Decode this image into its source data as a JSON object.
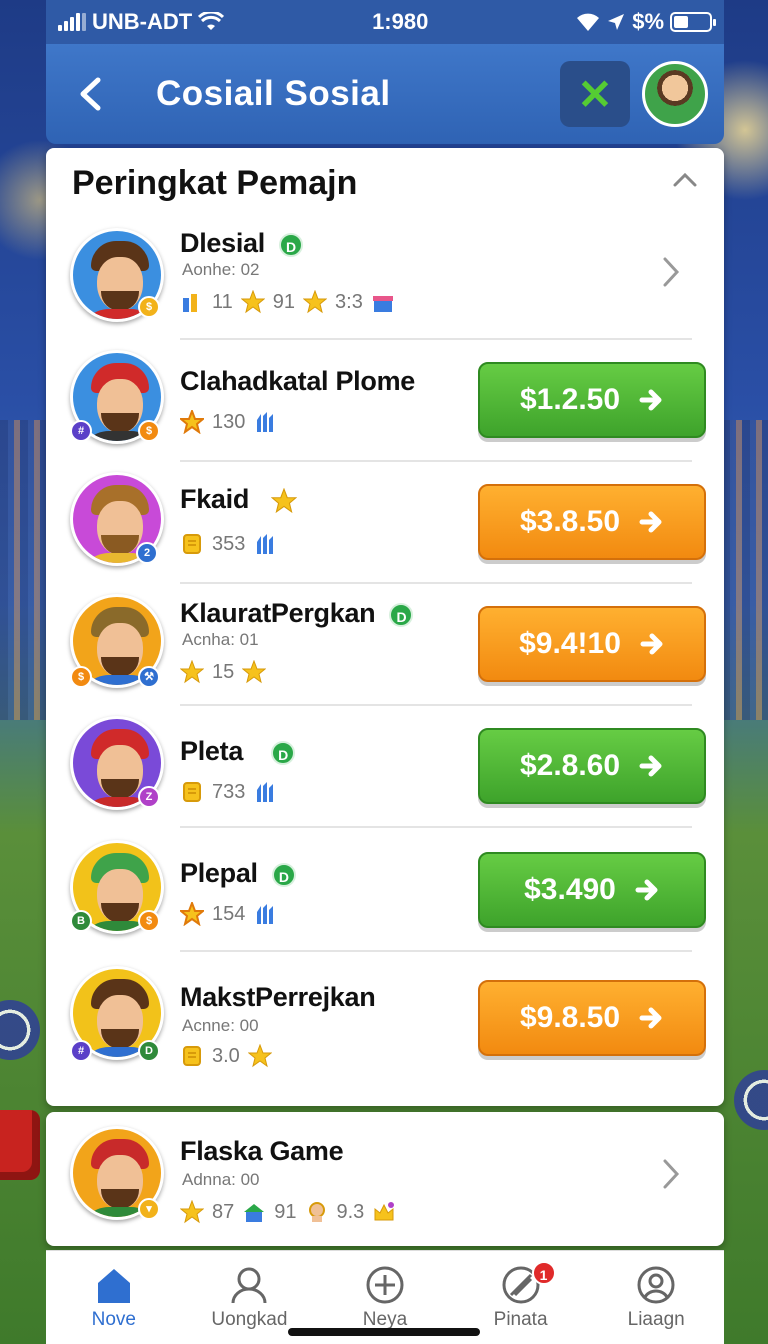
{
  "status_bar": {
    "carrier": "UNB-ADT",
    "time": "1:980",
    "right_text": "$%"
  },
  "header": {
    "title": "Cosiail Sosial"
  },
  "leaderboard": {
    "title": "Peringkat Pemajn",
    "rows": [
      {
        "name": "Dlesial",
        "sub": "Aonhe: 02",
        "stats": [
          "11",
          "91",
          "3:3"
        ],
        "action": "chevron"
      },
      {
        "name": "Clahadkatal Plome",
        "stats": [
          "130"
        ],
        "price": "$1.2.50",
        "btn_color": "green"
      },
      {
        "name": "Fkaid",
        "stats": [
          "353"
        ],
        "price": "$3.8.50",
        "btn_color": "orange"
      },
      {
        "name": "KlauratPergkan",
        "sub": "Acnha: 01",
        "stats": [
          "15"
        ],
        "price": "$9.4!10",
        "btn_color": "orange"
      },
      {
        "name": "Pleta",
        "stats": [
          "733"
        ],
        "price": "$2.8.60",
        "btn_color": "green"
      },
      {
        "name": "Plepal",
        "stats": [
          "154"
        ],
        "price": "$3.490",
        "btn_color": "green"
      },
      {
        "name": "MakstPerrejkan",
        "sub": "Acnne: 00",
        "stats": [
          "3.0"
        ],
        "price": "$9.8.50",
        "btn_color": "orange"
      }
    ]
  },
  "featured": {
    "name": "Flaska Game",
    "sub": "Adnna: 00",
    "stats": [
      "87",
      "91",
      "9.3"
    ]
  },
  "nav": {
    "items": [
      {
        "label": "Nove"
      },
      {
        "label": "Uongkad"
      },
      {
        "label": "Neya"
      },
      {
        "label": "Pinata",
        "badge": "1"
      },
      {
        "label": "Liaagn"
      }
    ]
  },
  "colors": {
    "header_blue": "#2f63b4",
    "green_button": "#3ea32b",
    "orange_button": "#f28a10",
    "nav_active": "#2f6fd0",
    "badge_red": "#e02a2a"
  }
}
